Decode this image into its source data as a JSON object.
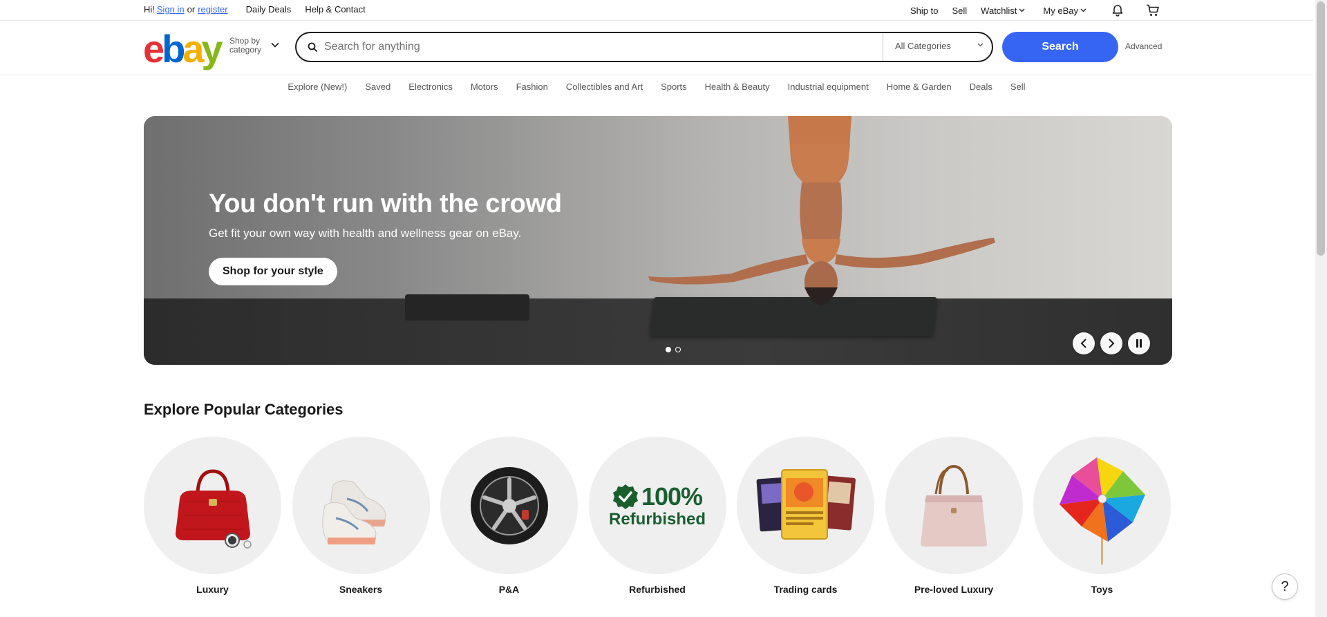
{
  "topbar": {
    "greeting": "Hi!",
    "sign_in": "Sign in",
    "or": "or",
    "register": "register",
    "daily_deals": "Daily Deals",
    "help_contact": "Help & Contact",
    "ship_to": "Ship to",
    "sell": "Sell",
    "watchlist": "Watchlist",
    "my_ebay": "My eBay",
    "icons": [
      "bell-icon",
      "cart-icon"
    ]
  },
  "header": {
    "logo": {
      "e": "e",
      "b": "b",
      "a": "a",
      "y": "y"
    },
    "shop_by_category": "Shop by category",
    "search_placeholder": "Search for anything",
    "category_select": "All Categories",
    "search_button": "Search",
    "advanced": "Advanced"
  },
  "nav": {
    "items": [
      "Explore (New!)",
      "Saved",
      "Electronics",
      "Motors",
      "Fashion",
      "Collectibles and Art",
      "Sports",
      "Health & Beauty",
      "Industrial equipment",
      "Home & Garden",
      "Deals",
      "Sell"
    ]
  },
  "hero": {
    "title": "You don't run with the crowd",
    "subtitle": "Get fit your own way with health and wellness gear on eBay.",
    "cta": "Shop for your style",
    "slide_count": 2,
    "active_slide": 1,
    "controls": [
      "chevron-left-icon",
      "chevron-right-icon",
      "pause-icon"
    ]
  },
  "categories": {
    "title": "Explore Popular Categories",
    "items": [
      {
        "label": "Luxury",
        "icon": "handbag-watch-image"
      },
      {
        "label": "Sneakers",
        "icon": "sneakers-image"
      },
      {
        "label": "P&A",
        "icon": "wheel-image"
      },
      {
        "label": "Refurbished",
        "icon": "refurbished-badge",
        "badge_text": "100%",
        "badge_sub": "Refurbished"
      },
      {
        "label": "Trading cards",
        "icon": "trading-cards-image"
      },
      {
        "label": "Pre-loved Luxury",
        "icon": "tote-bag-image"
      },
      {
        "label": "Toys",
        "icon": "pinwheel-image"
      }
    ]
  },
  "help_button": "?",
  "colors": {
    "brand_blue": "#3665f3",
    "logo_red": "#e53238",
    "logo_blue": "#0064d2",
    "logo_yellow": "#f5af02",
    "logo_green": "#86b817",
    "refurb_green": "#1a5e2e"
  }
}
